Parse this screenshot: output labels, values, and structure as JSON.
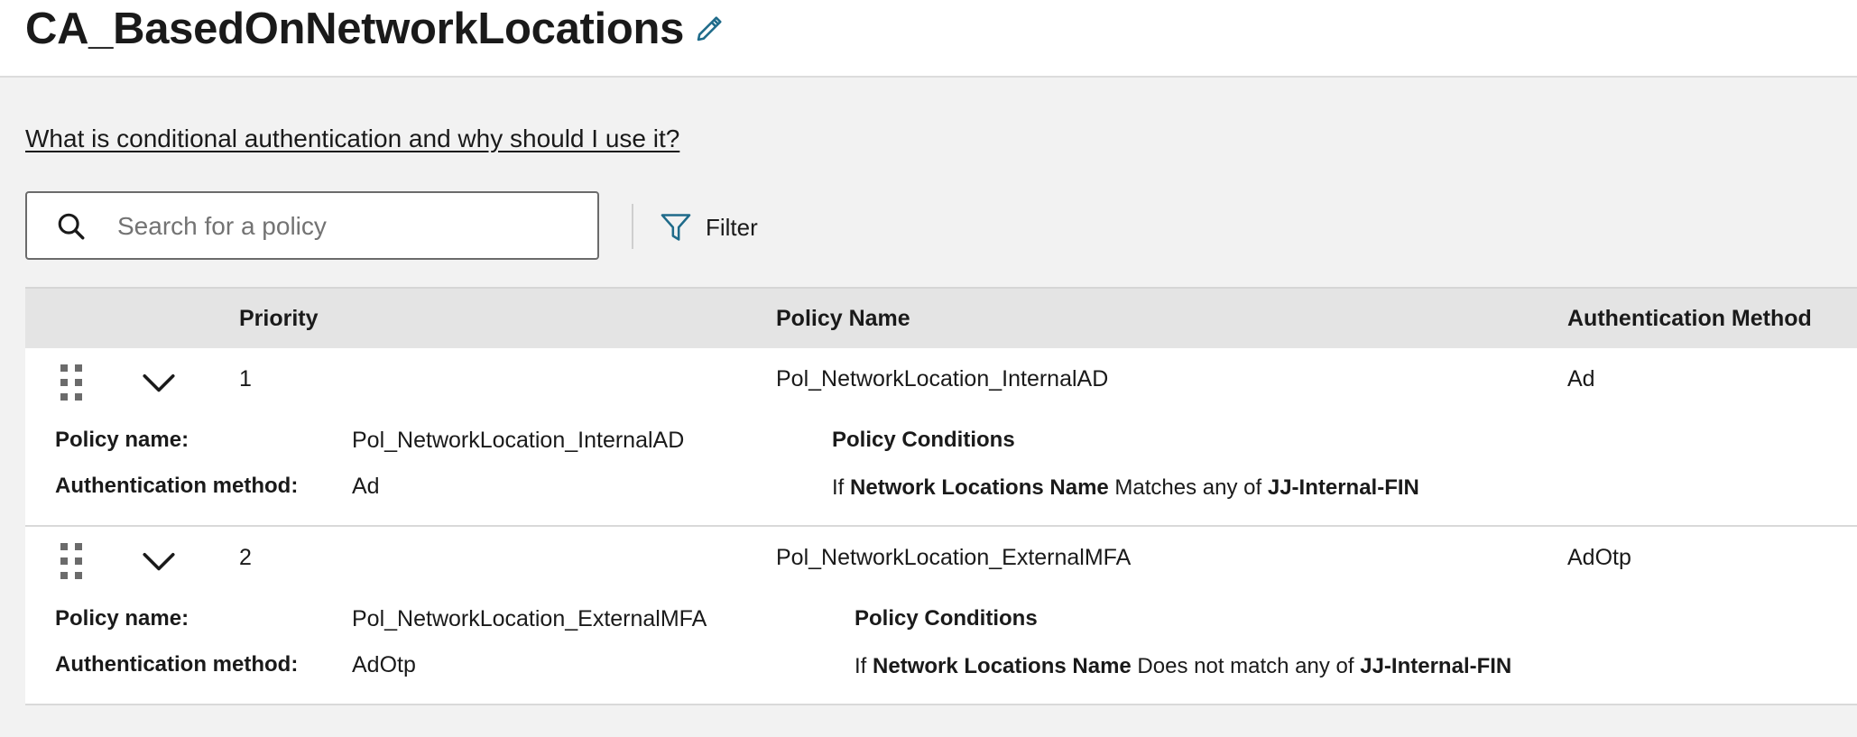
{
  "page": {
    "title": "CA_BasedOnNetworkLocations",
    "help_link": "What is conditional authentication and why should I use it?"
  },
  "search": {
    "placeholder": "Search for a policy",
    "value": ""
  },
  "toolbar": {
    "filter_label": "Filter"
  },
  "colors": {
    "accent_icon": "#1f6b8a",
    "header_bg": "#e4e4e4",
    "page_bg": "#f2f2f2"
  },
  "table": {
    "columns": {
      "priority": "Priority",
      "policy_name": "Policy Name",
      "auth_method": "Authentication Method"
    },
    "rows": [
      {
        "priority": "1",
        "policy_name": "Pol_NetworkLocation_InternalAD",
        "auth_method": "Ad",
        "details": {
          "policy_name_label": "Policy name:",
          "policy_name_value": "Pol_NetworkLocation_InternalAD",
          "auth_method_label": "Authentication method:",
          "auth_method_value": "Ad",
          "conditions_title": "Policy Conditions",
          "condition": {
            "prefix": "If",
            "field": "Network Locations Name",
            "operator": "Matches any of",
            "value": "JJ-Internal-FIN"
          }
        }
      },
      {
        "priority": "2",
        "policy_name": "Pol_NetworkLocation_ExternalMFA",
        "auth_method": "AdOtp",
        "details": {
          "policy_name_label": "Policy name:",
          "policy_name_value": "Pol_NetworkLocation_ExternalMFA",
          "auth_method_label": "Authentication method:",
          "auth_method_value": "AdOtp",
          "conditions_title": "Policy Conditions",
          "condition": {
            "prefix": "If",
            "field": "Network Locations Name",
            "operator": "Does not match any of",
            "value": "JJ-Internal-FIN"
          }
        }
      }
    ]
  }
}
